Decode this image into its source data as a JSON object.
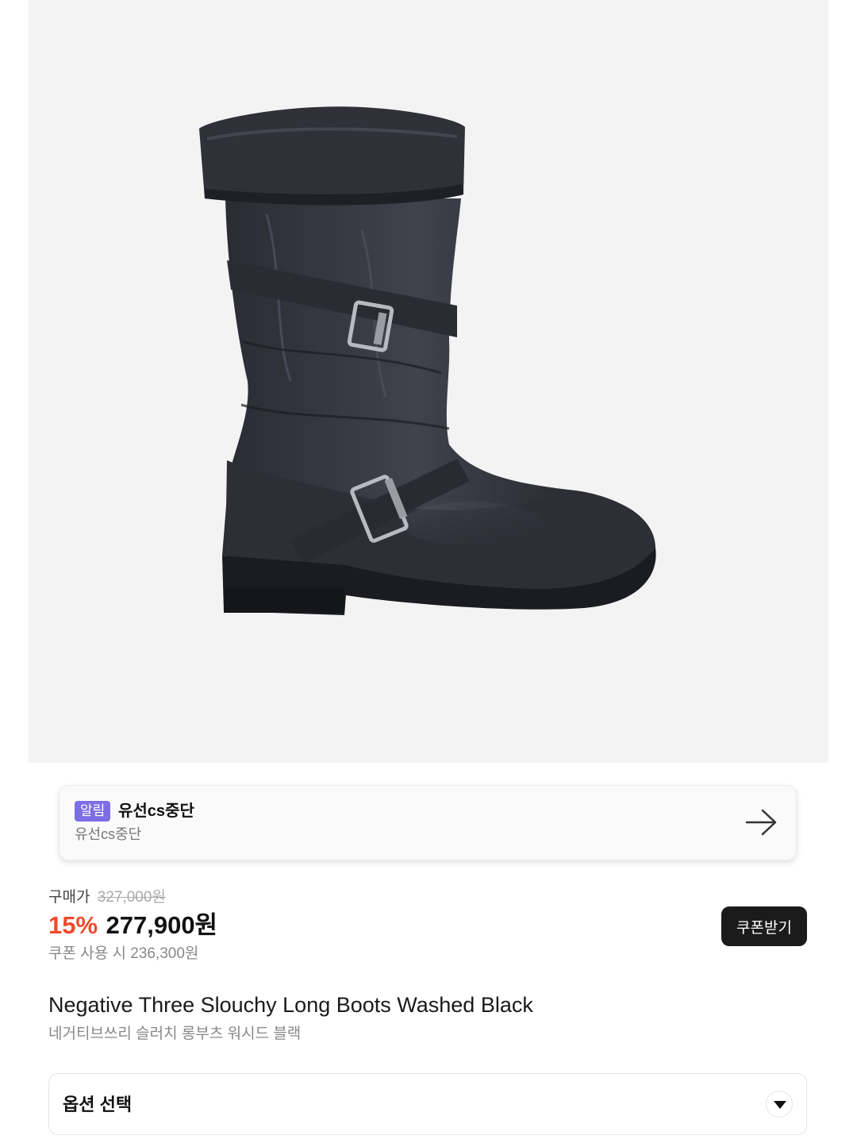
{
  "product_image": {
    "icon": "slouchy-long-boot-image"
  },
  "notice": {
    "badge": "알림",
    "title": "유선cs중단",
    "subtitle": "유선cs중단",
    "arrow_icon": "arrow-right-icon"
  },
  "price": {
    "label": "구매가",
    "original": "327,000원",
    "discount": "15%",
    "final": "277,900원",
    "coupon_price": "쿠폰 사용 시 236,300원",
    "discount_color": "#ee4b2b"
  },
  "coupon_button": {
    "label": "쿠폰받기"
  },
  "product": {
    "name_en": "Negative Three Slouchy Long Boots Washed Black",
    "name_ko": "네거티브쓰리 슬러치 롱부츠 워시드 블랙"
  },
  "option": {
    "label": "옵션 선택",
    "icon": "chevron-down-icon"
  }
}
